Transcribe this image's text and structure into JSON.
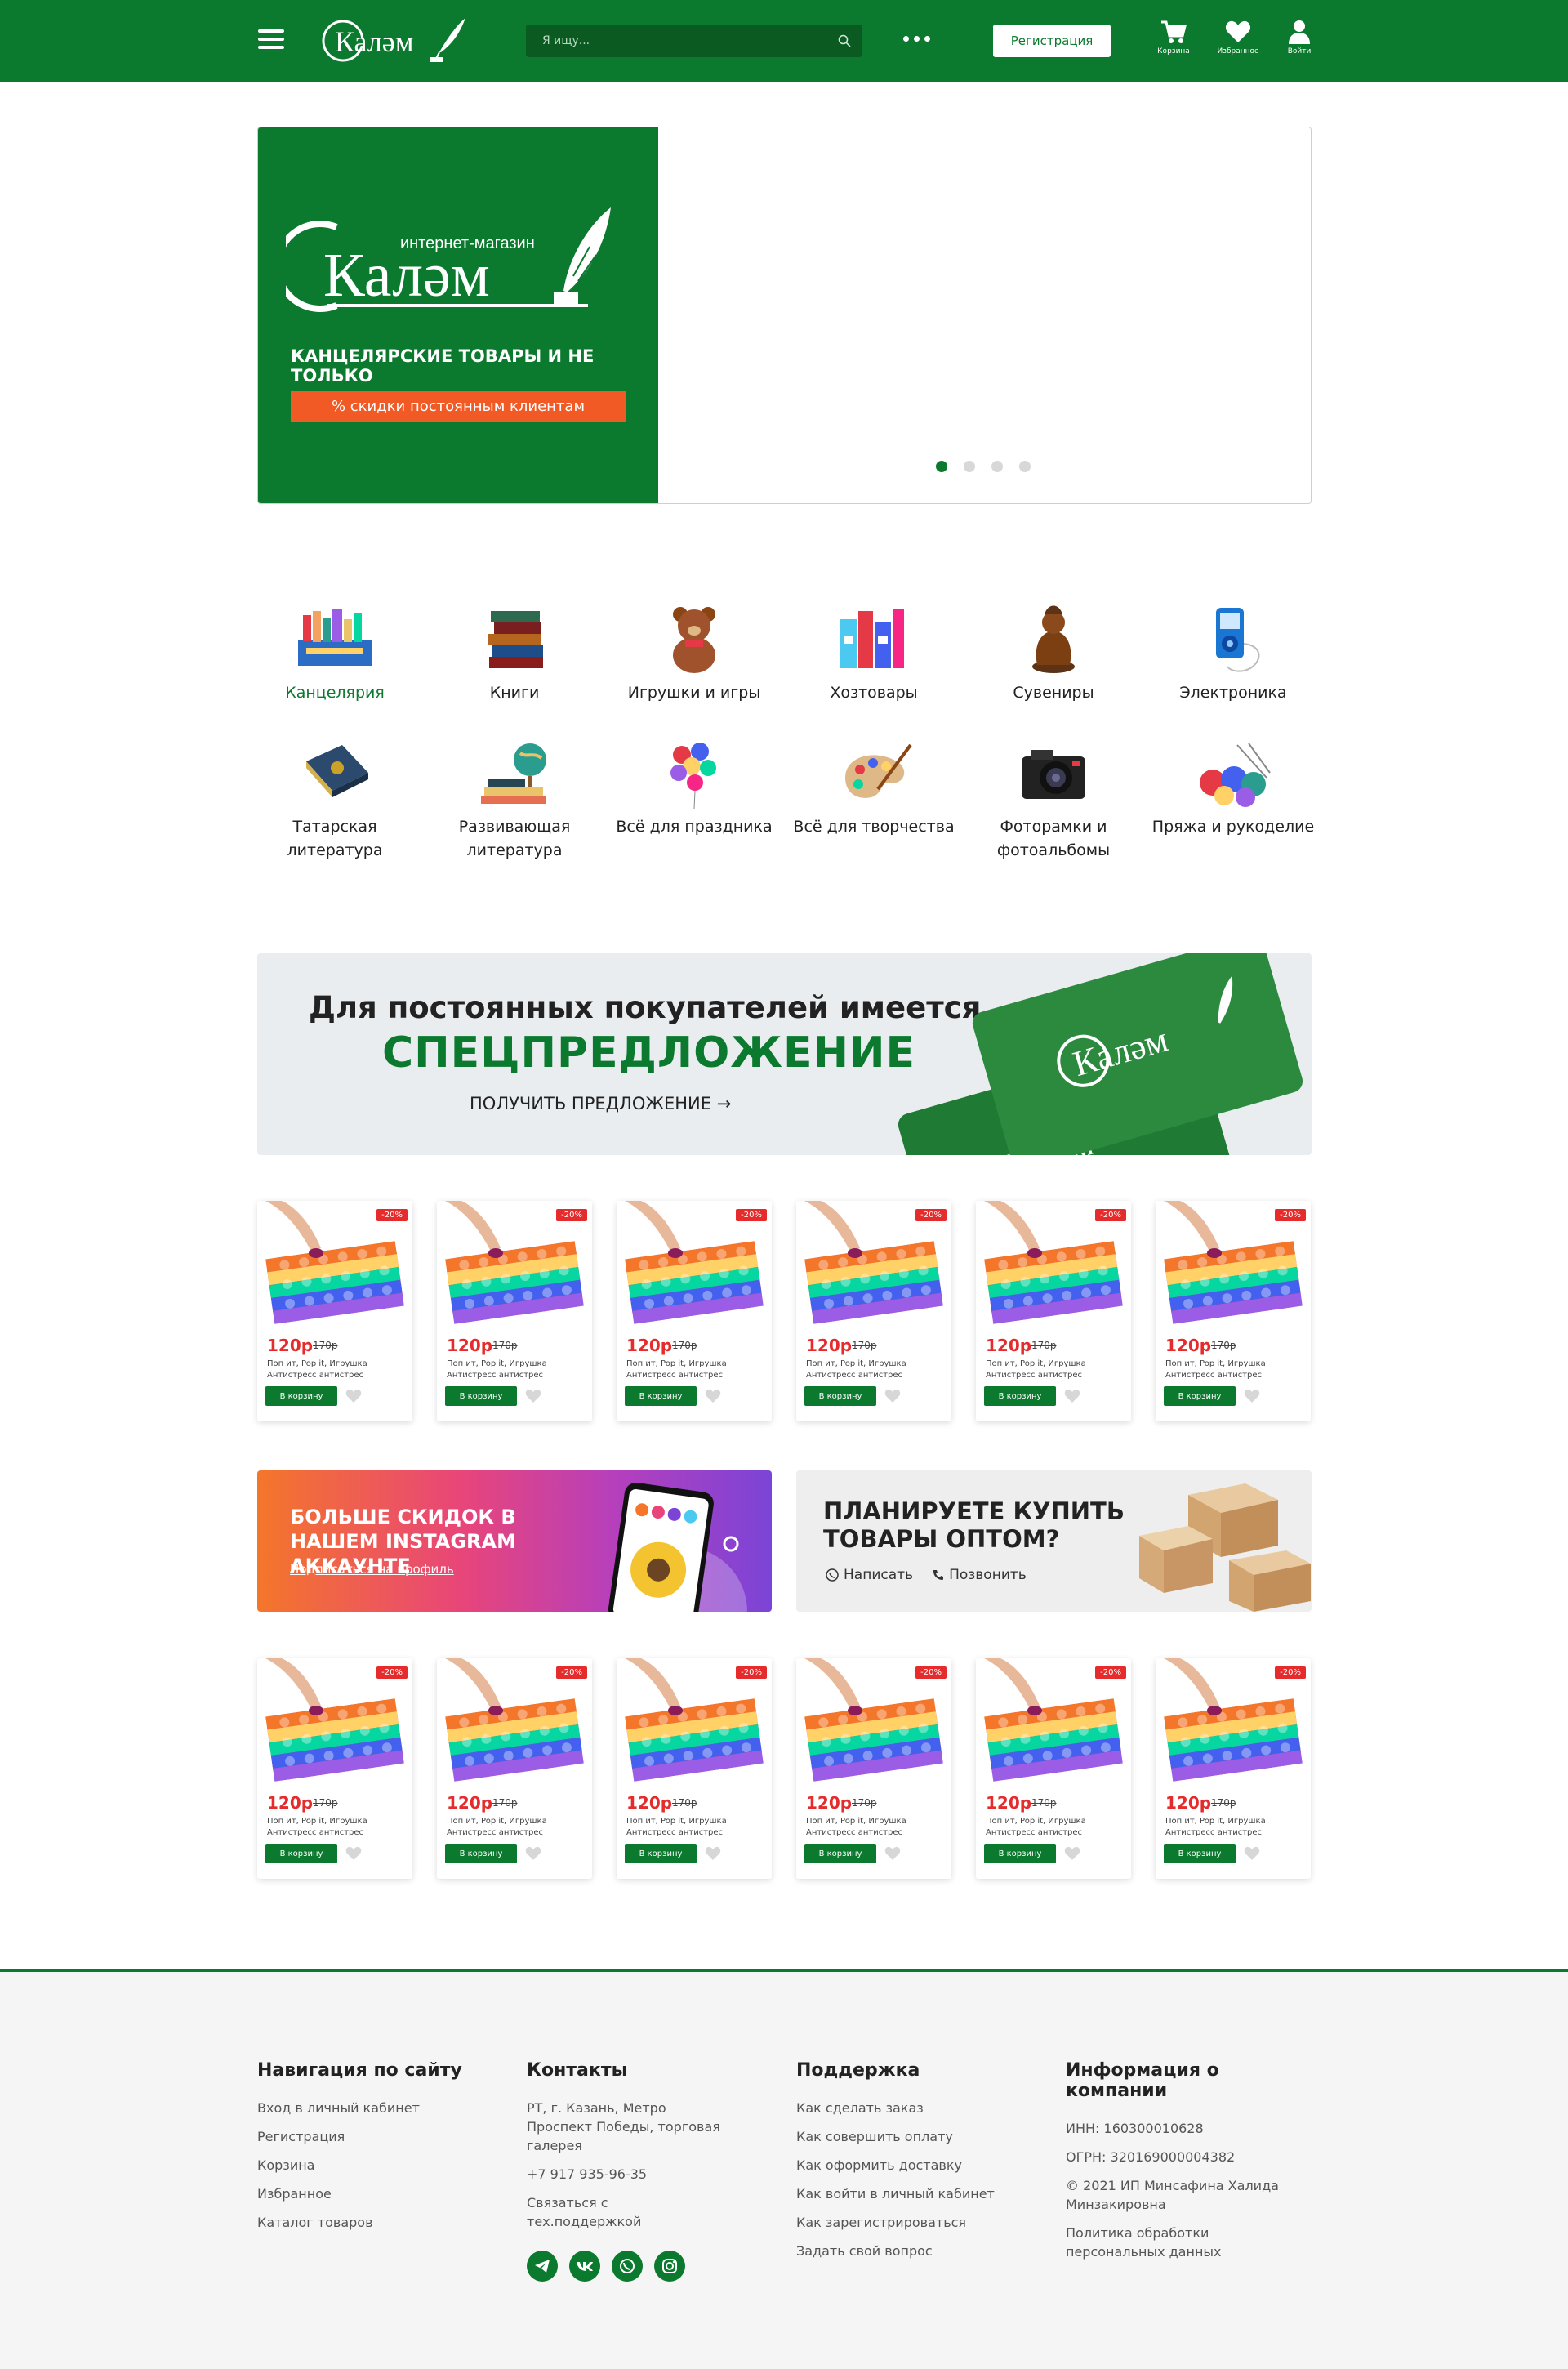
{
  "header": {
    "logo_text": "Калəм",
    "search_placeholder": "Я ищу...",
    "register_label": "Регистрация",
    "cart_label": "Корзина",
    "favorites_label": "Избранное",
    "login_label": "Войти"
  },
  "hero": {
    "logo_tagline": "интернет-магазин",
    "logo_text": "Калəм",
    "subtitle": "КАНЦЕЛЯРСКИЕ ТОВАРЫ И НЕ ТОЛЬКО",
    "cta": "% скидки постоянным клиентам",
    "slides_total": 4,
    "slide_active": 1
  },
  "categories": [
    {
      "name": "Канцелярия",
      "icon": "stationery-icon",
      "active": true
    },
    {
      "name": "Книги",
      "icon": "books-icon"
    },
    {
      "name": "Игрушки и игры",
      "icon": "teddy-bear-icon"
    },
    {
      "name": "Хозтовары",
      "icon": "household-goods-icon"
    },
    {
      "name": "Сувениры",
      "icon": "souvenir-figurine-icon"
    },
    {
      "name": "Электроника",
      "icon": "mp3-player-icon"
    },
    {
      "name": "Татарская литература",
      "icon": "tatar-book-icon"
    },
    {
      "name": "Развивающая литература",
      "icon": "globe-books-icon"
    },
    {
      "name": "Всё для праздника",
      "icon": "balloons-icon"
    },
    {
      "name": "Всё для творчества",
      "icon": "paint-palette-icon"
    },
    {
      "name": "Фоторамки и фотоальбомы",
      "icon": "camera-icon"
    },
    {
      "name": "Пряжа и рукоделие",
      "icon": "yarn-icon"
    }
  ],
  "promo": {
    "line1": "Для постоянных покупателей имеется",
    "line2": "СПЕЦПРЕДЛОЖЕНИЕ",
    "link": "ПОЛУЧИТЬ ПРЕДЛОЖЕНИЕ →",
    "card_text": "Калəм"
  },
  "product": {
    "badge": "-20%",
    "price": "120р",
    "old_price": "170р",
    "description": "Поп ит, Pop it, Игрушка Антистресс антистрес тактильная игрушка",
    "cart_label": "В корзину"
  },
  "instagram": {
    "title": "БОЛЬШЕ СКИДОК В НАШЕМ INSTAGRAM АККАУНТЕ",
    "link": "Подписаться на профиль"
  },
  "wholesale": {
    "title": "ПЛАНИРУЕТЕ КУПИТЬ ТОВАРЫ ОПТОМ?",
    "write": "Написать",
    "call": "Позвонить"
  },
  "footer": {
    "nav": {
      "title": "Навигация по сайту",
      "items": [
        "Вход в личный кабинет",
        "Регистрация",
        "Корзина",
        "Избранное",
        "Каталог товаров"
      ]
    },
    "contacts": {
      "title": "Контакты",
      "address": "РТ, г. Казань, Метро Проспект Победы, торговая галерея",
      "phone": "+7 917 935-96-35",
      "support": "Связаться с тех.поддержкой"
    },
    "support": {
      "title": "Поддержка",
      "items": [
        "Как сделать заказ",
        "Как совершить оплату",
        "Как оформить доставку",
        "Как войти в личный кабинет",
        "Как зарегистрироваться",
        "Задать свой вопрос"
      ]
    },
    "company": {
      "title": "Информация о компании",
      "inn": "ИНН: 160300010628",
      "ogrn": "ОГРН: 320169000004382",
      "copyright": "© 2021 ИП Минсафина Халида Минзакировна",
      "privacy": "Политика обработки персональных данных"
    }
  },
  "colors": {
    "brand_green": "#0b7a2e",
    "price_red": "#e52b2b",
    "accent_orange": "#f15a24"
  }
}
